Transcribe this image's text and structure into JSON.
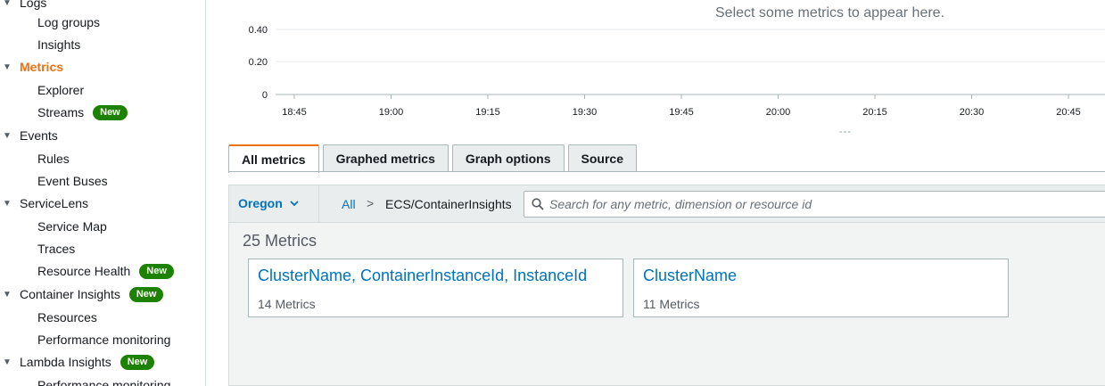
{
  "sidebar": {
    "logs": {
      "label": "Logs"
    },
    "log_groups": {
      "label": "Log groups"
    },
    "logs_insights": {
      "label": "Insights"
    },
    "metrics": {
      "label": "Metrics"
    },
    "explorer": {
      "label": "Explorer"
    },
    "streams": {
      "label": "Streams",
      "badge": "New"
    },
    "events": {
      "label": "Events"
    },
    "rules": {
      "label": "Rules"
    },
    "event_buses": {
      "label": "Event Buses"
    },
    "servicelens": {
      "label": "ServiceLens"
    },
    "service_map": {
      "label": "Service Map"
    },
    "traces": {
      "label": "Traces"
    },
    "resource_health": {
      "label": "Resource Health",
      "badge": "New"
    },
    "container_insights": {
      "label": "Container Insights",
      "badge": "New"
    },
    "ci_resources": {
      "label": "Resources"
    },
    "ci_perf": {
      "label": "Performance monitoring"
    },
    "lambda_insights": {
      "label": "Lambda Insights",
      "badge": "New"
    },
    "li_perf": {
      "label": "Performance monitoring"
    }
  },
  "chart": {
    "empty_message": "Select some metrics to appear here.",
    "y_ticks": [
      "0.40",
      "0.20",
      "0"
    ],
    "x_ticks": [
      "18:45",
      "19:00",
      "19:15",
      "19:30",
      "19:45",
      "20:00",
      "20:15",
      "20:30",
      "20:45"
    ],
    "resize_handle": "---"
  },
  "tabs": {
    "all_metrics": "All metrics",
    "graphed_metrics": "Graphed metrics",
    "graph_options": "Graph options",
    "source": "Source"
  },
  "toolbar": {
    "region": "Oregon",
    "breadcrumb_all": "All",
    "breadcrumb_separator": ">",
    "breadcrumb_current": "ECS/ContainerInsights",
    "search_placeholder": "Search for any metric, dimension or resource id"
  },
  "results": {
    "count": "25 Metrics",
    "cards": [
      {
        "title": "ClusterName, ContainerInstanceId, InstanceId",
        "subtitle": "14 Metrics"
      },
      {
        "title": "ClusterName",
        "subtitle": "11 Metrics"
      }
    ]
  },
  "colors": {
    "accent": "#ec7211",
    "link": "#0073bb",
    "badge": "#1d8102"
  }
}
